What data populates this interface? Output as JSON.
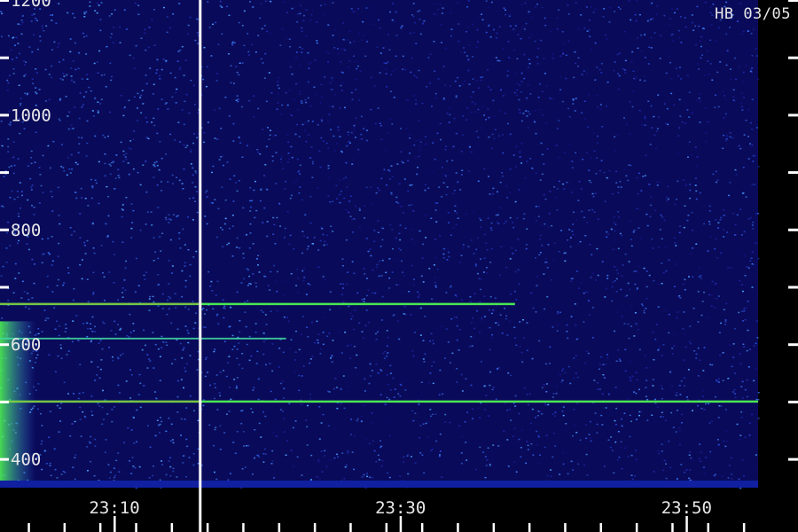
{
  "chart_data": {
    "type": "heatmap",
    "label": "HB 03/05",
    "y_axis": {
      "unit": "",
      "range": [
        350,
        1200
      ],
      "ticks": [
        400,
        600,
        800,
        1000,
        1200
      ],
      "minor_step": 100
    },
    "x_axis": {
      "range": [
        "23:02",
        "23:55"
      ],
      "ticks": [
        "23:10",
        "23:30",
        "23:50"
      ],
      "minor_step_minutes": 2.5
    },
    "marker_time": "23:16",
    "bright_lines": [
      {
        "freq": 500,
        "start": "23:02",
        "end": "23:55",
        "intensity": "high"
      },
      {
        "freq": 610,
        "start": "23:02",
        "end": "23:22",
        "intensity": "medium"
      },
      {
        "freq": 670,
        "start": "23:02",
        "end": "23:38",
        "intensity": "high"
      }
    ],
    "colors": {
      "background": "#000000",
      "low": "#0a0a6e",
      "mid": "#3a8cff",
      "high": "#50ff50",
      "peak": "#ff6020",
      "marker": "#ffffff",
      "text": "#e8e8e8"
    }
  }
}
